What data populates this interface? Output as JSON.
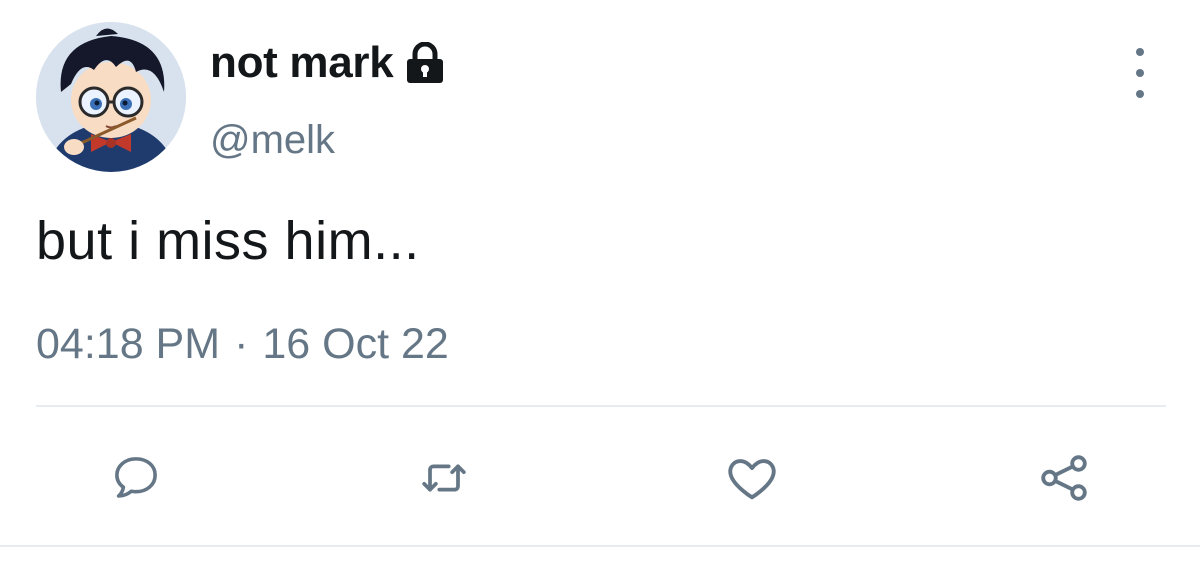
{
  "user": {
    "display_name": "not mark",
    "handle": "@melk",
    "protected_icon": "lock-icon",
    "avatar": "anime-character-avatar"
  },
  "tweet": {
    "text": "but i miss him...",
    "time": "04:18 PM",
    "separator": "·",
    "date": "16 Oct 22"
  },
  "actions": {
    "reply_icon": "speech-bubble-icon",
    "retweet_icon": "retweet-arrows-icon",
    "like_icon": "heart-icon",
    "share_icon": "share-nodes-icon",
    "more_icon": "vertical-ellipsis-icon"
  },
  "colors": {
    "text_primary": "#14171a",
    "text_secondary": "#657786",
    "divider": "#e6ecf0"
  }
}
